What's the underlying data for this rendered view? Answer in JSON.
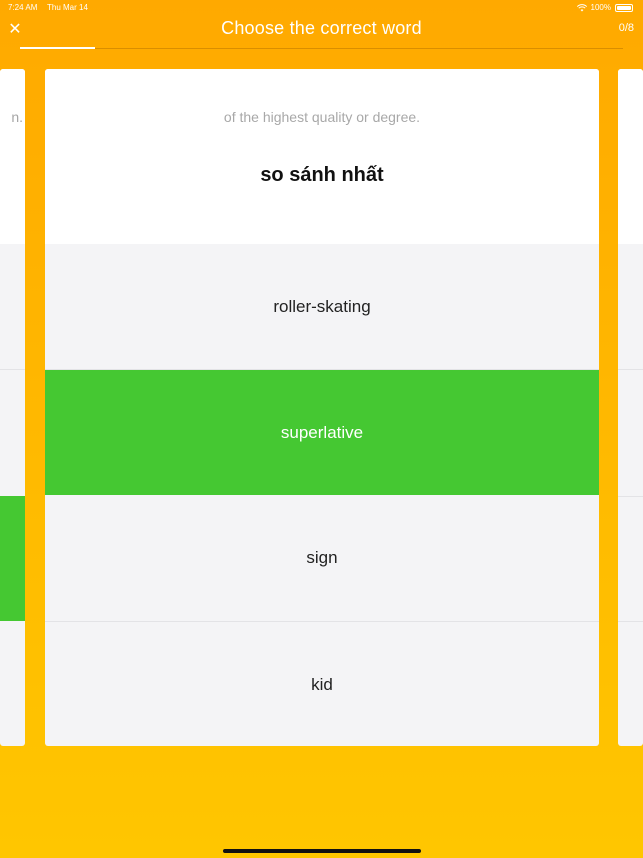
{
  "status_bar": {
    "time": "7:24 AM",
    "date": "Thu Mar 14",
    "battery": "100%"
  },
  "header": {
    "title": "Choose the correct word",
    "close_icon": "close-icon",
    "right_label": "0/8",
    "progress_fraction": 0.125
  },
  "left_card": {
    "partial_text": "n."
  },
  "card": {
    "definition": "of the highest quality or degree.",
    "translation": "so sánh nhất",
    "options": [
      {
        "label": "roller-skating",
        "state": "default"
      },
      {
        "label": "superlative",
        "state": "correct"
      },
      {
        "label": "sign",
        "state": "default"
      },
      {
        "label": "kid",
        "state": "default"
      }
    ]
  },
  "colors": {
    "accent_top": "#FFA900",
    "accent_bottom": "#FFC600",
    "correct": "#45C832"
  }
}
